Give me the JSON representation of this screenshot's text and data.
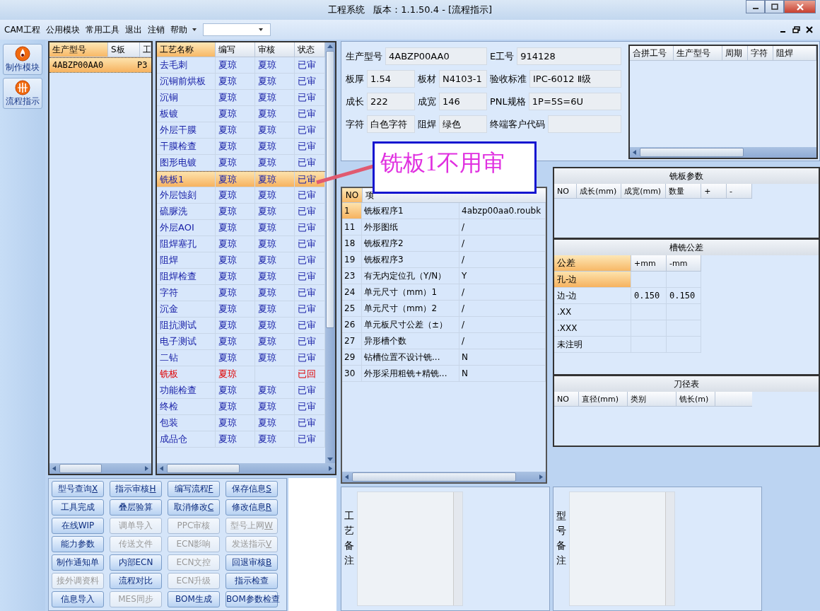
{
  "window": {
    "title": "工程系统   版本：1.1.50.4 - [流程指示]"
  },
  "menu": [
    "CAM工程",
    "公用模块",
    "常用工具",
    "退出",
    "注销",
    "帮助"
  ],
  "nav": [
    {
      "label": "制作模块"
    },
    {
      "label": "流程指示"
    }
  ],
  "models": {
    "columns": [
      "生产型号",
      "S板",
      "工"
    ],
    "rows": [
      {
        "model": "4ABZP00AA0",
        "column_3": "P3",
        "selected": true
      }
    ]
  },
  "process": {
    "columns": [
      "工艺名称",
      "编写",
      "审核",
      "状态"
    ],
    "rows": [
      {
        "name": "去毛刺",
        "writer": "夏琼",
        "reviewer": "夏琼",
        "status": "已审",
        "returned": false,
        "selected": false
      },
      {
        "name": "沉铜前烘板",
        "writer": "夏琼",
        "reviewer": "夏琼",
        "status": "已审",
        "returned": false,
        "selected": false
      },
      {
        "name": "沉铜",
        "writer": "夏琼",
        "reviewer": "夏琼",
        "status": "已审",
        "returned": false,
        "selected": false
      },
      {
        "name": "板镀",
        "writer": "夏琼",
        "reviewer": "夏琼",
        "status": "已审",
        "returned": false,
        "selected": false
      },
      {
        "name": "外层干膜",
        "writer": "夏琼",
        "reviewer": "夏琼",
        "status": "已审",
        "returned": false,
        "selected": false
      },
      {
        "name": "干膜检查",
        "writer": "夏琼",
        "reviewer": "夏琼",
        "status": "已审",
        "returned": false,
        "selected": false
      },
      {
        "name": "图形电镀",
        "writer": "夏琼",
        "reviewer": "夏琼",
        "status": "已审",
        "returned": false,
        "selected": false
      },
      {
        "name": "铣板1",
        "writer": "夏琼",
        "reviewer": "夏琼",
        "status": "已审",
        "returned": false,
        "selected": true
      },
      {
        "name": "外层蚀刻",
        "writer": "夏琼",
        "reviewer": "夏琼",
        "status": "已审",
        "returned": false,
        "selected": false
      },
      {
        "name": "硫脲洗",
        "writer": "夏琼",
        "reviewer": "夏琼",
        "status": "已审",
        "returned": false,
        "selected": false
      },
      {
        "name": "外层AOI",
        "writer": "夏琼",
        "reviewer": "夏琼",
        "status": "已审",
        "returned": false,
        "selected": false
      },
      {
        "name": "阻焊塞孔",
        "writer": "夏琼",
        "reviewer": "夏琼",
        "status": "已审",
        "returned": false,
        "selected": false
      },
      {
        "name": "阻焊",
        "writer": "夏琼",
        "reviewer": "夏琼",
        "status": "已审",
        "returned": false,
        "selected": false
      },
      {
        "name": "阻焊检查",
        "writer": "夏琼",
        "reviewer": "夏琼",
        "status": "已审",
        "returned": false,
        "selected": false
      },
      {
        "name": "字符",
        "writer": "夏琼",
        "reviewer": "夏琼",
        "status": "已审",
        "returned": false,
        "selected": false
      },
      {
        "name": "沉金",
        "writer": "夏琼",
        "reviewer": "夏琼",
        "status": "已审",
        "returned": false,
        "selected": false
      },
      {
        "name": "阻抗测试",
        "writer": "夏琼",
        "reviewer": "夏琼",
        "status": "已审",
        "returned": false,
        "selected": false
      },
      {
        "name": "电子测试",
        "writer": "夏琼",
        "reviewer": "夏琼",
        "status": "已审",
        "returned": false,
        "selected": false
      },
      {
        "name": "二钻",
        "writer": "夏琼",
        "reviewer": "夏琼",
        "status": "已审",
        "returned": false,
        "selected": false
      },
      {
        "name": "铣板",
        "writer": "夏琼",
        "status": "已回",
        "returned": true,
        "selected": false
      },
      {
        "name": "功能检查",
        "writer": "夏琼",
        "reviewer": "夏琼",
        "status": "已审",
        "returned": false,
        "selected": false
      },
      {
        "name": "终检",
        "writer": "夏琼",
        "reviewer": "夏琼",
        "status": "已审",
        "returned": false,
        "selected": false
      },
      {
        "name": "包装",
        "writer": "夏琼",
        "reviewer": "夏琼",
        "status": "已审",
        "returned": false,
        "selected": false
      },
      {
        "name": "成品仓",
        "writer": "夏琼",
        "reviewer": "夏琼",
        "status": "已审",
        "returned": false,
        "selected": false
      }
    ]
  },
  "buttons": [
    {
      "label": "型号查询",
      "key": "X",
      "disabled": false
    },
    {
      "label": "指示审核",
      "key": "H",
      "disabled": false
    },
    {
      "label": "编写流程",
      "key": "F",
      "disabled": false
    },
    {
      "label": "保存信息",
      "key": "S",
      "disabled": false
    },
    {
      "label": "工具完成",
      "disabled": false
    },
    {
      "label": "叠层验算",
      "disabled": false
    },
    {
      "label": "取消修改",
      "key": "C",
      "disabled": false
    },
    {
      "label": "修改信息",
      "key": "R",
      "disabled": false
    },
    {
      "label": "在线WIP",
      "disabled": false
    },
    {
      "label": "调单导入",
      "disabled": true
    },
    {
      "label": "PPC审核",
      "disabled": true
    },
    {
      "label": "型号上网",
      "key": "W",
      "disabled": true
    },
    {
      "label": "能力参数",
      "disabled": false
    },
    {
      "label": "传送文件",
      "disabled": true
    },
    {
      "label": "ECN影响",
      "disabled": true
    },
    {
      "label": "发送指示",
      "key": "V",
      "disabled": true
    },
    {
      "label": "制作通知单",
      "disabled": false
    },
    {
      "label": "内部ECN",
      "disabled": false
    },
    {
      "label": "ECN文控",
      "disabled": true
    },
    {
      "label": "回退审核",
      "key": "B",
      "disabled": false
    },
    {
      "label": "接外调资料",
      "disabled": true
    },
    {
      "label": "流程对比",
      "disabled": false
    },
    {
      "label": "ECN升级",
      "disabled": true
    },
    {
      "label": "指示检查",
      "disabled": false
    },
    {
      "label": "信息导入",
      "disabled": false
    },
    {
      "label": "MES同步",
      "disabled": true
    },
    {
      "label": "BOM生成",
      "disabled": false
    },
    {
      "label": "BOM参数检查",
      "disabled": false
    }
  ],
  "info": {
    "fields": [
      {
        "label": "生产型号",
        "value": "4ABZP00AA0"
      },
      {
        "label": "E工号",
        "value": "914128"
      },
      {
        "label": "板厚",
        "value": "1.54"
      },
      {
        "label": "板材",
        "value": "N4103-1"
      },
      {
        "label": "验收标准",
        "value": "IPC-6012 Ⅱ级"
      },
      {
        "label": "成长",
        "value": "222"
      },
      {
        "label": "成宽",
        "value": "146"
      },
      {
        "label": "PNL规格",
        "value": "1P=5S=6U"
      },
      {
        "label": "字符",
        "value": "白色字符"
      },
      {
        "label": "阻焊",
        "value": "绿色"
      },
      {
        "label": "终端客户代码"
      }
    ]
  },
  "merge_table": {
    "columns": [
      "合拼工号",
      "生产型号",
      "周期",
      "字符",
      "阻焊"
    ]
  },
  "callout": {
    "text": "铣板1不用审"
  },
  "milling_items": {
    "columns": [
      "NO",
      "项"
    ],
    "rows": [
      {
        "no": "1",
        "item": "铣板程序1",
        "value": "4abzp00aa0.roubk",
        "selected": true
      },
      {
        "no": "11",
        "item": "外形图纸",
        "value": "/",
        "selected": false
      },
      {
        "no": "18",
        "item": "铣板程序2",
        "value": "/",
        "selected": false
      },
      {
        "no": "19",
        "item": "铣板程序3",
        "value": "/",
        "selected": false
      },
      {
        "no": "23",
        "item": "有无内定位孔（Y/N）",
        "value": "Y",
        "selected": false
      },
      {
        "no": "24",
        "item": "单元尺寸（mm）1",
        "value": "/",
        "selected": false
      },
      {
        "no": "25",
        "item": "单元尺寸（mm）2",
        "value": "/",
        "selected": false
      },
      {
        "no": "26",
        "item": "单元板尺寸公差（±）",
        "value": "/",
        "selected": false
      },
      {
        "no": "27",
        "item": "异形槽个数",
        "value": "/",
        "selected": false
      },
      {
        "no": "29",
        "item": "钻槽位置不设计铣...",
        "value": "N",
        "selected": false
      },
      {
        "no": "30",
        "item": "外形采用粗铣+精铣...",
        "value": "N",
        "selected": false
      }
    ]
  },
  "mill_params": {
    "title": "铣板参数",
    "columns": [
      "NO",
      "成长(mm)",
      "成宽(mm)",
      "数量",
      "+",
      "-"
    ]
  },
  "slot_tolerance": {
    "title": "槽铣公差",
    "columns": [
      "公差",
      "+mm",
      "-mm"
    ],
    "rows": [
      {
        "name": "孔-边",
        "selected": true
      },
      {
        "name": "边-边",
        "plus": "0.150",
        "minus": "0.150",
        "selected": false
      },
      {
        "name": ".XX",
        "selected": false
      },
      {
        "name": ".XXX",
        "selected": false
      },
      {
        "name": "未注明",
        "selected": false
      }
    ]
  },
  "tool_table": {
    "title": "刀径表",
    "columns": [
      "NO",
      "直径(mm)",
      "类别",
      "铣长(m)"
    ]
  },
  "remarks": [
    {
      "label": "工艺备注"
    },
    {
      "label": "型号备注"
    }
  ]
}
